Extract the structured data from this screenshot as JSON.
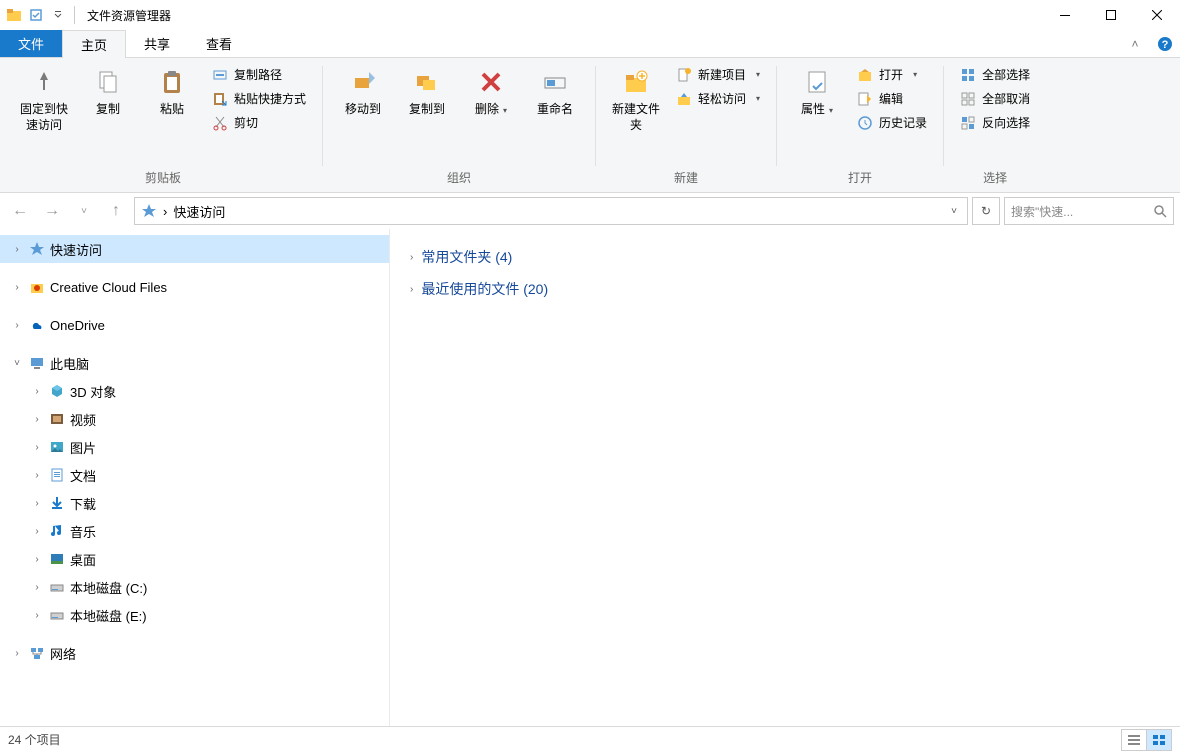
{
  "titlebar": {
    "title": "文件资源管理器"
  },
  "tabs": {
    "file": "文件",
    "home": "主页",
    "share": "共享",
    "view": "查看"
  },
  "ribbon": {
    "clipboard": {
      "label": "剪贴板",
      "pin": "固定到快速访问",
      "copy": "复制",
      "paste": "粘贴",
      "copy_path": "复制路径",
      "paste_shortcut": "粘贴快捷方式",
      "cut": "剪切"
    },
    "organize": {
      "label": "组织",
      "move_to": "移动到",
      "copy_to": "复制到",
      "delete": "删除",
      "rename": "重命名"
    },
    "new": {
      "label": "新建",
      "new_folder": "新建文件夹",
      "new_item": "新建项目",
      "easy_access": "轻松访问"
    },
    "open": {
      "label": "打开",
      "properties": "属性",
      "open": "打开",
      "edit": "编辑",
      "history": "历史记录"
    },
    "select": {
      "label": "选择",
      "select_all": "全部选择",
      "select_none": "全部取消",
      "invert": "反向选择"
    }
  },
  "breadcrumb": {
    "current": "快速访问"
  },
  "search": {
    "placeholder": "搜索\"快速..."
  },
  "sidebar": {
    "quick_access": "快速访问",
    "creative_cloud": "Creative Cloud Files",
    "onedrive": "OneDrive",
    "this_pc": "此电脑",
    "objects_3d": "3D 对象",
    "videos": "视频",
    "pictures": "图片",
    "documents": "文档",
    "downloads": "下载",
    "music": "音乐",
    "desktop": "桌面",
    "disk_c": "本地磁盘 (C:)",
    "disk_e": "本地磁盘 (E:)",
    "network": "网络"
  },
  "main": {
    "frequent_folders": "常用文件夹 (4)",
    "recent_files": "最近使用的文件 (20)"
  },
  "statusbar": {
    "item_count": "24 个项目"
  }
}
